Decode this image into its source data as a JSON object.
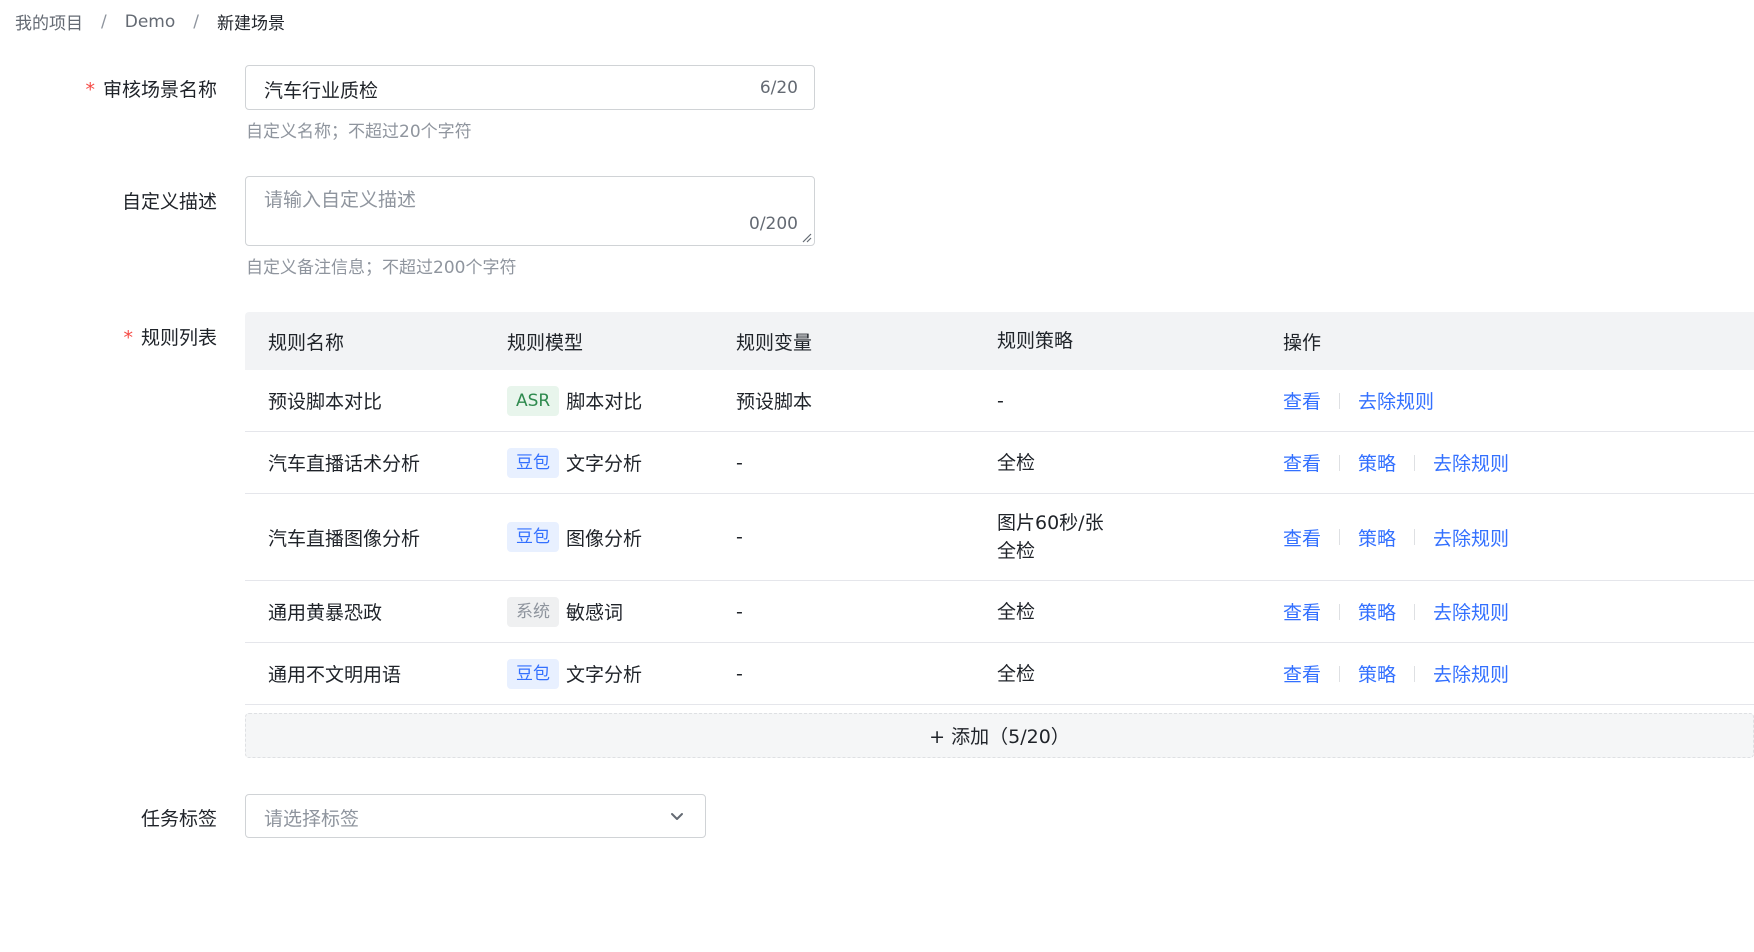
{
  "breadcrumb": {
    "items": [
      "我的项目",
      "Demo",
      "新建场景"
    ],
    "separator": "/"
  },
  "form": {
    "scene_name": {
      "label": "审核场景名称",
      "value": "汽车行业质检",
      "count": "6/20",
      "hint": "自定义名称；不超过20个字符"
    },
    "description": {
      "label": "自定义描述",
      "placeholder": "请输入自定义描述",
      "count": "0/200",
      "hint": "自定义备注信息；不超过200个字符"
    },
    "rules": {
      "label": "规则列表",
      "headers": [
        "规则名称",
        "规则模型",
        "规则变量",
        "规则策略",
        "操作"
      ],
      "rows": [
        {
          "name": "预设脚本对比",
          "tag": "ASR",
          "tag_type": "asr",
          "model": "脚本对比",
          "variable": "预设脚本",
          "strategy": [
            "-"
          ],
          "actions": [
            "查看",
            "去除规则"
          ]
        },
        {
          "name": "汽车直播话术分析",
          "tag": "豆包",
          "tag_type": "doubao",
          "model": "文字分析",
          "variable": "-",
          "strategy": [
            "全检"
          ],
          "actions": [
            "查看",
            "策略",
            "去除规则"
          ]
        },
        {
          "name": "汽车直播图像分析",
          "tag": "豆包",
          "tag_type": "doubao",
          "model": "图像分析",
          "variable": "-",
          "strategy": [
            "图片60秒/张",
            "全检"
          ],
          "actions": [
            "查看",
            "策略",
            "去除规则"
          ]
        },
        {
          "name": "通用黄暴恐政",
          "tag": "系统",
          "tag_type": "sys",
          "model": "敏感词",
          "variable": "-",
          "strategy": [
            "全检"
          ],
          "actions": [
            "查看",
            "策略",
            "去除规则"
          ]
        },
        {
          "name": "通用不文明用语",
          "tag": "豆包",
          "tag_type": "doubao",
          "model": "文字分析",
          "variable": "-",
          "strategy": [
            "全检"
          ],
          "actions": [
            "查看",
            "策略",
            "去除规则"
          ]
        }
      ],
      "add_label": "+ 添加（5/20）"
    },
    "task_tag": {
      "label": "任务标签",
      "placeholder": "请选择标签"
    }
  },
  "colors": {
    "link": "#3370ff",
    "required": "#f54a45",
    "header_bg": "#f2f3f5"
  },
  "icons": {
    "select": "chevron-down-icon",
    "textarea": "resize-grip-icon"
  }
}
